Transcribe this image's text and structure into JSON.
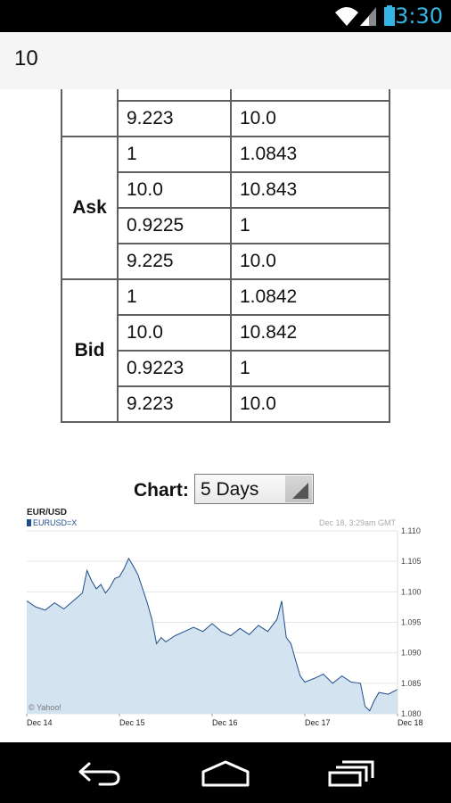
{
  "status_bar": {
    "time": "3:30",
    "icons": [
      "wifi-icon",
      "cell-signal-icon",
      "battery-icon"
    ]
  },
  "input": {
    "value": "10"
  },
  "rates_table": {
    "partial_rows": [
      {
        "left": "9.223",
        "right": "10.0"
      }
    ],
    "groups": [
      {
        "label": "Ask",
        "rows": [
          {
            "left": "1",
            "right": "1.0843"
          },
          {
            "left": "10.0",
            "right": "10.843"
          },
          {
            "left": "0.9225",
            "right": "1"
          },
          {
            "left": "9.225",
            "right": "10.0"
          }
        ]
      },
      {
        "label": "Bid",
        "rows": [
          {
            "left": "1",
            "right": "1.0842"
          },
          {
            "left": "10.0",
            "right": "10.842"
          },
          {
            "left": "0.9223",
            "right": "1"
          },
          {
            "left": "9.223",
            "right": "10.0"
          }
        ]
      }
    ]
  },
  "chart_selector": {
    "label": "Chart:",
    "selected": "5 Days"
  },
  "chart_data": {
    "type": "area",
    "title": "EUR/USD",
    "legend": "EURUSD=X",
    "timestamp": "Dec 18, 3:29am GMT",
    "credit": "© Yahoo!",
    "x_ticks": [
      "Dec 14",
      "Dec 15",
      "Dec 16",
      "Dec 17",
      "Dec 18"
    ],
    "y_ticks": [
      "1.110",
      "1.105",
      "1.100",
      "1.095",
      "1.090",
      "1.085",
      "1.080"
    ],
    "ylim": [
      1.08,
      1.11
    ],
    "grid": true,
    "colors": {
      "line": "#1f4e8c",
      "fill": "#d3e3f0"
    },
    "x": [
      0,
      0.1,
      0.2,
      0.3,
      0.4,
      0.5,
      0.6,
      0.65,
      0.7,
      0.75,
      0.8,
      0.85,
      0.9,
      0.95,
      1.0,
      1.05,
      1.1,
      1.15,
      1.2,
      1.25,
      1.3,
      1.35,
      1.4,
      1.45,
      1.5,
      1.6,
      1.7,
      1.8,
      1.9,
      2.0,
      2.1,
      2.2,
      2.3,
      2.4,
      2.5,
      2.6,
      2.7,
      2.75,
      2.8,
      2.85,
      2.9,
      2.95,
      3.0,
      3.1,
      3.2,
      3.3,
      3.4,
      3.5,
      3.6,
      3.65,
      3.7,
      3.75,
      3.8,
      3.9,
      4.0
    ],
    "values": [
      1.0985,
      1.0975,
      1.097,
      1.0982,
      1.0972,
      1.0985,
      1.0998,
      1.1035,
      1.1018,
      1.1005,
      1.1012,
      1.0998,
      1.1008,
      1.1022,
      1.1025,
      1.1038,
      1.1055,
      1.1042,
      1.1028,
      1.1005,
      1.0982,
      1.0955,
      1.0915,
      1.0925,
      1.0918,
      1.0928,
      1.0935,
      1.0942,
      1.0935,
      1.0948,
      1.0935,
      1.0928,
      1.094,
      1.093,
      1.0945,
      1.0935,
      1.0955,
      1.0985,
      1.0925,
      1.0915,
      1.0888,
      1.0862,
      1.0852,
      1.0858,
      1.0865,
      1.085,
      1.0862,
      1.0852,
      1.085,
      1.0812,
      1.0805,
      1.0822,
      1.0835,
      1.0832,
      1.084
    ]
  },
  "nav_bar": {
    "buttons": [
      "back-icon",
      "home-icon",
      "recents-icon"
    ]
  }
}
